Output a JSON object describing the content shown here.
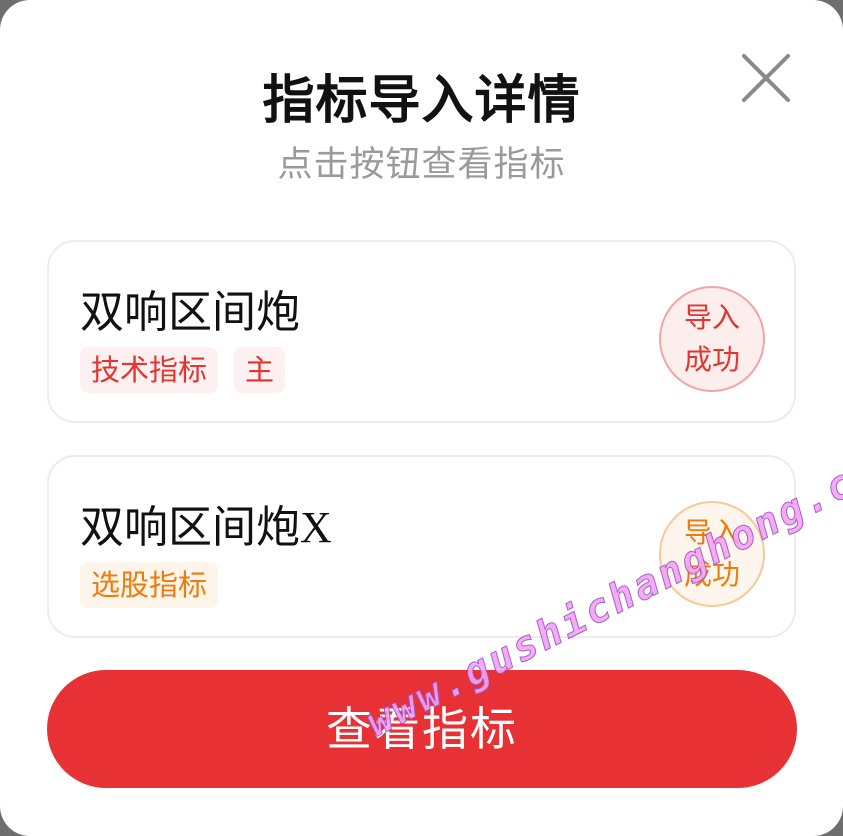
{
  "dialog": {
    "title": "指标导入详情",
    "subtitle": "点击按钮查看指标",
    "close_icon": "close-icon"
  },
  "indicators": [
    {
      "name": "双响区间炮",
      "tags": [
        "技术指标",
        "主"
      ],
      "status_line1": "导入",
      "status_line2": "成功",
      "accent": "#e3342f"
    },
    {
      "name_cjk": "双响区间炮",
      "name_latin": "X",
      "tags": [
        "选股指标"
      ],
      "status_line1": "导入",
      "status_line2": "成功",
      "accent": "#ef7b0a"
    }
  ],
  "actions": {
    "primary_label": "查看指标",
    "primary_color": "#e83134"
  },
  "watermark": "www.gushichanghong.com"
}
